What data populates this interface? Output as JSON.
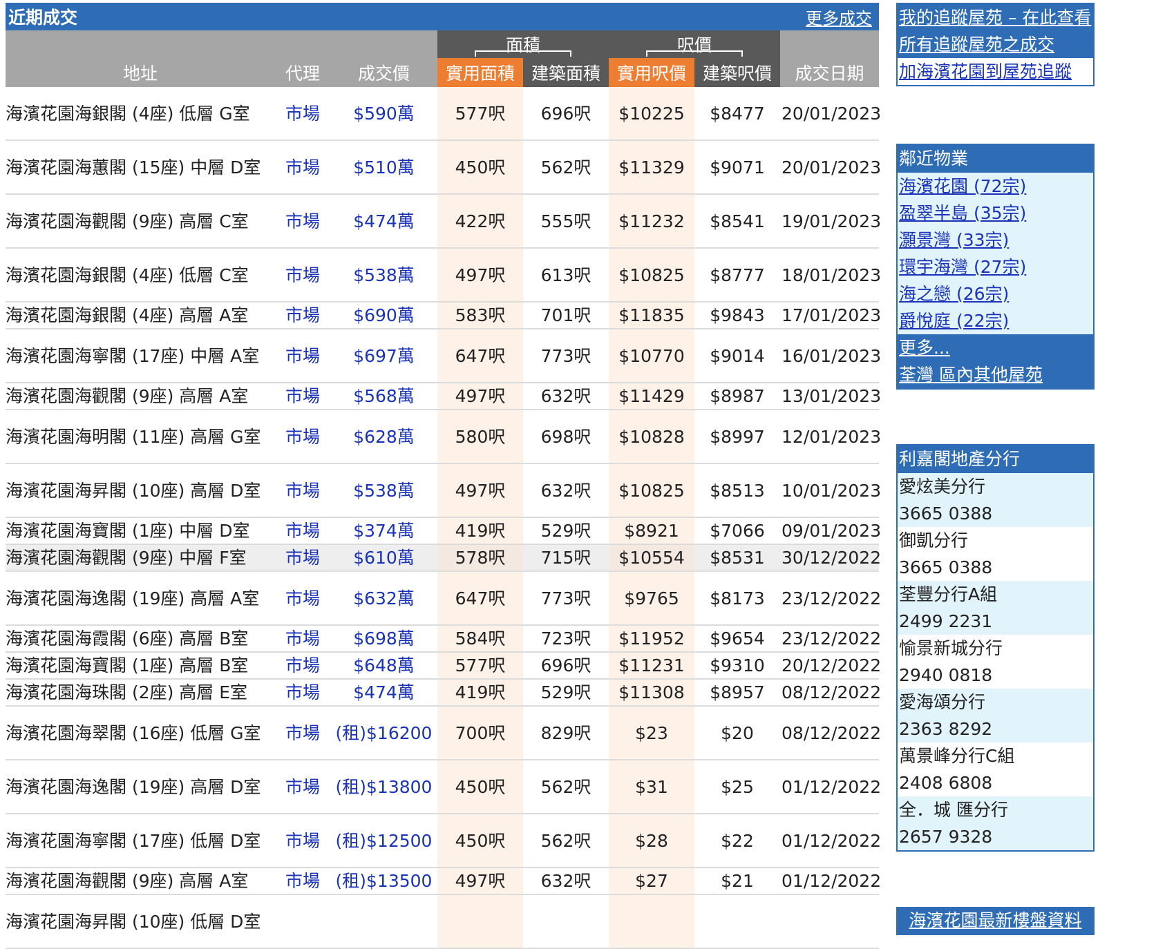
{
  "panel": {
    "title": "近期成交",
    "more_link": "更多成交"
  },
  "table": {
    "group_headers": {
      "area": "面積",
      "psf": "呎價"
    },
    "columns": [
      "地址",
      "代理",
      "成交價",
      "實用面積",
      "建築面積",
      "實用呎價",
      "建築呎價",
      "成交日期"
    ],
    "rows": [
      {
        "addr": "海濱花園海銀閣 (4座) 低層 G室",
        "agent": "市場",
        "price": "$590萬",
        "sa": "577呎",
        "ga": "696呎",
        "spsf": "$10225",
        "gpsf": "$8477",
        "date": "20/01/2023",
        "tall": true
      },
      {
        "addr": "海濱花園海蕙閣 (15座) 中層 D室",
        "agent": "市場",
        "price": "$510萬",
        "sa": "450呎",
        "ga": "562呎",
        "spsf": "$11329",
        "gpsf": "$9071",
        "date": "20/01/2023",
        "tall": true
      },
      {
        "addr": "海濱花園海觀閣 (9座) 高層 C室",
        "agent": "市場",
        "price": "$474萬",
        "sa": "422呎",
        "ga": "555呎",
        "spsf": "$11232",
        "gpsf": "$8541",
        "date": "19/01/2023",
        "tall": true
      },
      {
        "addr": "海濱花園海銀閣 (4座) 低層 C室",
        "agent": "市場",
        "price": "$538萬",
        "sa": "497呎",
        "ga": "613呎",
        "spsf": "$10825",
        "gpsf": "$8777",
        "date": "18/01/2023",
        "tall": true
      },
      {
        "addr": "海濱花園海銀閣 (4座) 高層 A室",
        "agent": "市場",
        "price": "$690萬",
        "sa": "583呎",
        "ga": "701呎",
        "spsf": "$11835",
        "gpsf": "$9843",
        "date": "17/01/2023",
        "tall": false
      },
      {
        "addr": "海濱花園海寧閣 (17座) 中層 A室",
        "agent": "市場",
        "price": "$697萬",
        "sa": "647呎",
        "ga": "773呎",
        "spsf": "$10770",
        "gpsf": "$9014",
        "date": "16/01/2023",
        "tall": true
      },
      {
        "addr": "海濱花園海觀閣 (9座) 高層 A室",
        "agent": "市場",
        "price": "$568萬",
        "sa": "497呎",
        "ga": "632呎",
        "spsf": "$11429",
        "gpsf": "$8987",
        "date": "13/01/2023",
        "tall": false
      },
      {
        "addr": "海濱花園海明閣 (11座) 高層 G室",
        "agent": "市場",
        "price": "$628萬",
        "sa": "580呎",
        "ga": "698呎",
        "spsf": "$10828",
        "gpsf": "$8997",
        "date": "12/01/2023",
        "tall": true
      },
      {
        "addr": "海濱花園海昇閣 (10座) 高層 D室",
        "agent": "市場",
        "price": "$538萬",
        "sa": "497呎",
        "ga": "632呎",
        "spsf": "$10825",
        "gpsf": "$8513",
        "date": "10/01/2023",
        "tall": true
      },
      {
        "addr": "海濱花園海寶閣 (1座) 中層 D室",
        "agent": "市場",
        "price": "$374萬",
        "sa": "419呎",
        "ga": "529呎",
        "spsf": "$8921",
        "gpsf": "$7066",
        "date": "09/01/2023",
        "tall": false
      },
      {
        "addr": "海濱花園海觀閣 (9座) 中層 F室",
        "agent": "市場",
        "price": "$610萬",
        "sa": "578呎",
        "ga": "715呎",
        "spsf": "$10554",
        "gpsf": "$8531",
        "date": "30/12/2022",
        "tall": false,
        "selected": true
      },
      {
        "addr": "海濱花園海逸閣 (19座) 高層 A室",
        "agent": "市場",
        "price": "$632萬",
        "sa": "647呎",
        "ga": "773呎",
        "spsf": "$9765",
        "gpsf": "$8173",
        "date": "23/12/2022",
        "tall": true
      },
      {
        "addr": "海濱花園海霞閣 (6座) 高層 B室",
        "agent": "市場",
        "price": "$698萬",
        "sa": "584呎",
        "ga": "723呎",
        "spsf": "$11952",
        "gpsf": "$9654",
        "date": "23/12/2022",
        "tall": false
      },
      {
        "addr": "海濱花園海寶閣 (1座) 高層 B室",
        "agent": "市場",
        "price": "$648萬",
        "sa": "577呎",
        "ga": "696呎",
        "spsf": "$11231",
        "gpsf": "$9310",
        "date": "20/12/2022",
        "tall": false
      },
      {
        "addr": "海濱花園海珠閣 (2座) 高層 E室",
        "agent": "市場",
        "price": "$474萬",
        "sa": "419呎",
        "ga": "529呎",
        "spsf": "$11308",
        "gpsf": "$8957",
        "date": "08/12/2022",
        "tall": false
      },
      {
        "addr": "海濱花園海翠閣 (16座) 低層 G室",
        "agent": "市場",
        "price": "(租)$16200",
        "sa": "700呎",
        "ga": "829呎",
        "spsf": "$23",
        "gpsf": "$20",
        "date": "08/12/2022",
        "tall": true
      },
      {
        "addr": "海濱花園海逸閣 (19座) 高層 D室",
        "agent": "市場",
        "price": "(租)$13800",
        "sa": "450呎",
        "ga": "562呎",
        "spsf": "$31",
        "gpsf": "$25",
        "date": "01/12/2022",
        "tall": true
      },
      {
        "addr": "海濱花園海寧閣 (17座) 低層 D室",
        "agent": "市場",
        "price": "(租)$12500",
        "sa": "450呎",
        "ga": "562呎",
        "spsf": "$28",
        "gpsf": "$22",
        "date": "01/12/2022",
        "tall": true
      },
      {
        "addr": "海濱花園海觀閣 (9座) 高層 A室",
        "agent": "市場",
        "price": "(租)$13500",
        "sa": "497呎",
        "ga": "632呎",
        "spsf": "$27",
        "gpsf": "$21",
        "date": "01/12/2022",
        "tall": false
      },
      {
        "addr": "海濱花園海昇閣 (10座) 低層 D室",
        "agent": "",
        "price": "",
        "sa": "",
        "ga": "",
        "spsf": "",
        "gpsf": "",
        "date": "",
        "tall": true
      }
    ]
  },
  "tracking": {
    "view_link": "我的追蹤屋苑 – 在此查看",
    "all_link": "所有追蹤屋苑之成交",
    "add_link": "加海濱花園到屋苑追蹤"
  },
  "nearby": {
    "title": "鄰近物業",
    "items": [
      "海濱花園 (72宗)",
      "盈翠半島 (35宗)",
      "灝景灣 (33宗)",
      "環宇海灣 (27宗)",
      "海之戀 (26宗)",
      "爵悅庭 (22宗)"
    ],
    "more_link": "更多...",
    "district_link": "荃灣 區內其他屋苑"
  },
  "branches": {
    "title": "利嘉閣地產分行",
    "items": [
      {
        "name": "愛炫美分行",
        "phone": "3665 0388"
      },
      {
        "name": "御凱分行",
        "phone": "3665 0388"
      },
      {
        "name": "荃豐分行A組",
        "phone": "2499 2231"
      },
      {
        "name": "愉景新城分行",
        "phone": "2940 0818"
      },
      {
        "name": "愛海頌分行",
        "phone": "2363 8292"
      },
      {
        "name": "萬景峰分行C組",
        "phone": "2408 6808"
      },
      {
        "name": "全．城 匯分行",
        "phone": "2657 9328"
      }
    ]
  },
  "footer_link": "海濱花園最新樓盤資料"
}
